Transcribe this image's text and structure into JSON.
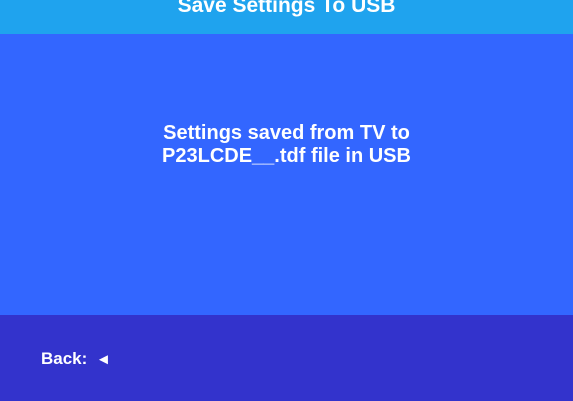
{
  "title": "Save Settings To USB",
  "message": {
    "line1": "Settings saved from TV to",
    "line2": "P23LCDE__.tdf file in USB"
  },
  "footer": {
    "back_label": "Back:",
    "back_arrow": "◄"
  },
  "colors": {
    "title_bar": "#1fa3ee",
    "message_panel": "#3366ff",
    "footer_bar": "#3333cc",
    "text": "#ffffff"
  }
}
